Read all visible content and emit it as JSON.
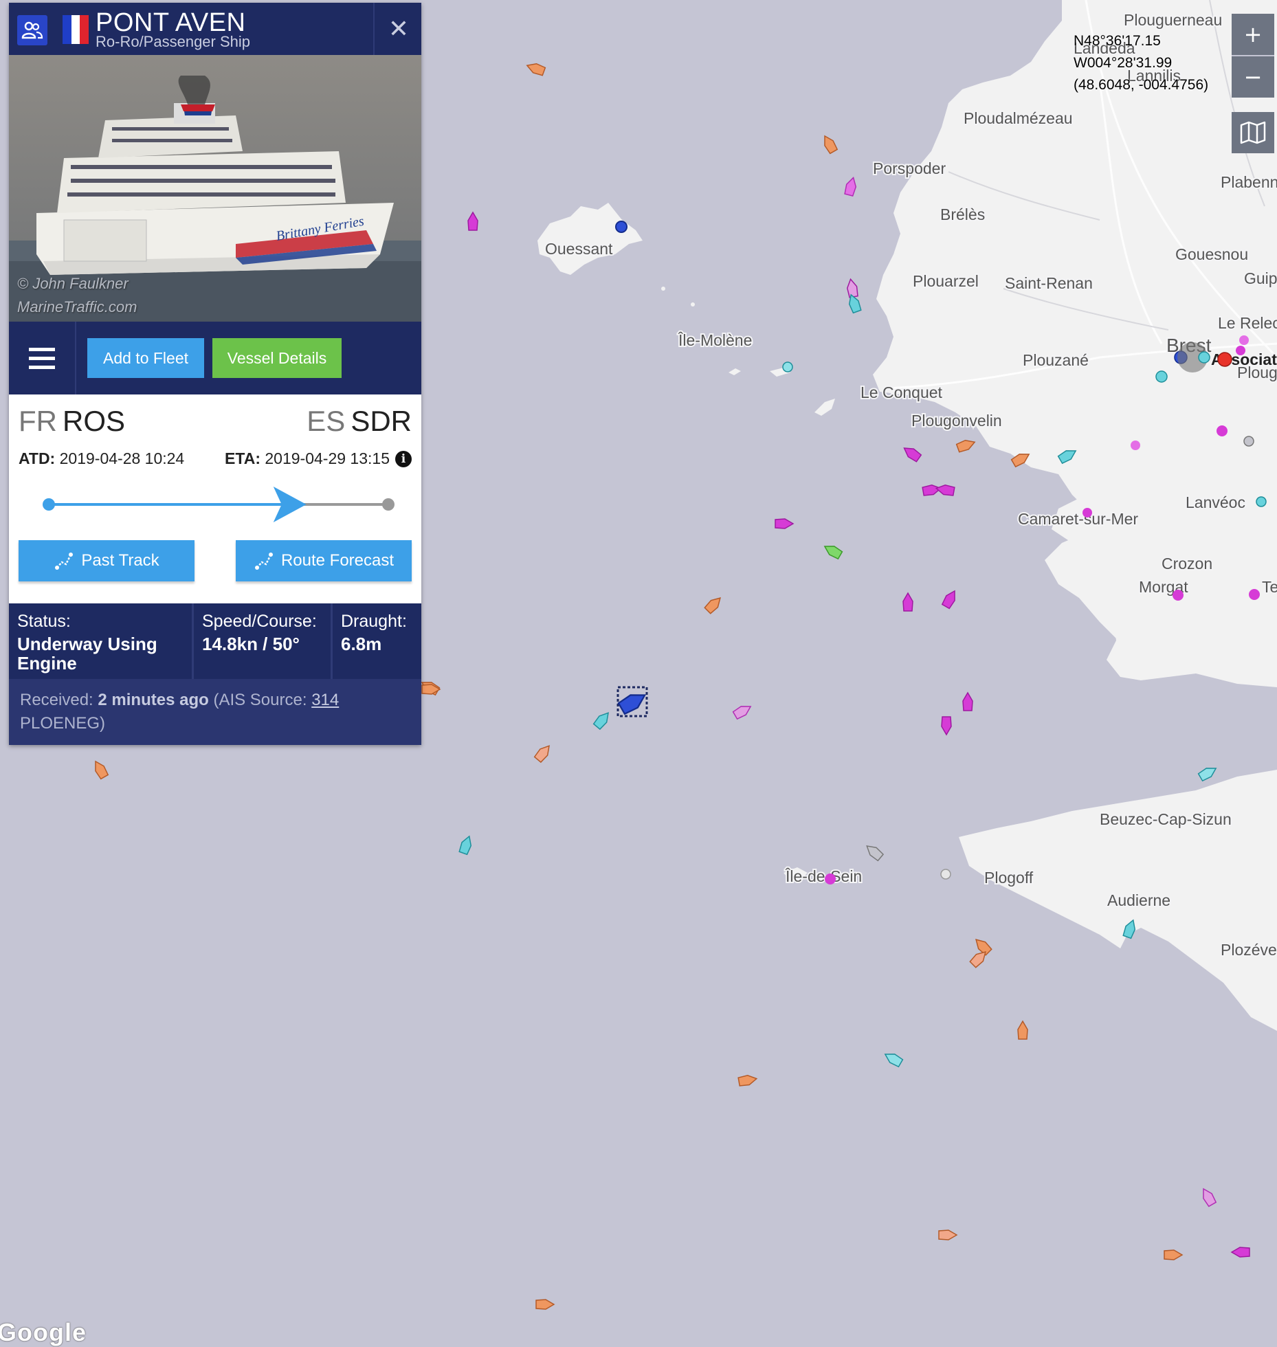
{
  "vessel": {
    "name": "PONT AVEN",
    "type": "Ro-Ro/Passenger Ship",
    "flag_colors": [
      "#1f3ec7",
      "#ffffff",
      "#e0242e"
    ],
    "photo_credit_line1": "© John Faulkner",
    "photo_credit_line2": "MarineTraffic.com",
    "ship_livery": "Brittany Ferries"
  },
  "actions": {
    "add_fleet": "Add to Fleet",
    "vessel_details": "Vessel Details",
    "past_track": "Past Track",
    "route_forecast": "Route Forecast"
  },
  "voyage": {
    "from_country": "FR",
    "from_port": "ROS",
    "to_country": "ES",
    "to_port": "SDR",
    "atd_label": "ATD:",
    "atd_value": "2019-04-28 10:24",
    "eta_label": "ETA:",
    "eta_value": "2019-04-29 13:15",
    "progress_fraction": 0.71
  },
  "status": {
    "status_label": "Status:",
    "status_value": "Underway Using Engine",
    "speed_label": "Speed/Course:",
    "speed_value": "14.8kn / 50°",
    "draught_label": "Draught:",
    "draught_value": "6.8m",
    "received_label": "Received:",
    "received_value": "2 minutes ago",
    "ais_source_label": "(AIS Source:",
    "ais_source_id": "314",
    "ais_source_station": "PLOENEG)"
  },
  "map": {
    "coord_lat": "N48°36'17.15",
    "coord_lon": "W004°28'31.99",
    "coord_decimal": "(48.6048, -004.4756)",
    "zoom_in": "+",
    "zoom_out": "−",
    "layers_icon": "map-icon",
    "google_logo": "Google",
    "places": [
      "Plouguerneau",
      "Landeda",
      "Lannilis",
      "Ploudalmézeau",
      "Porspoder",
      "Plabennec",
      "Brélès",
      "Gouesnou",
      "Ouessant",
      "Guip",
      "Plouarzel",
      "Saint-Renan",
      "Le Relec",
      "Île-Molène",
      "Brest",
      "Association",
      "Ploug",
      "Plouzané",
      "Le Conquet",
      "Plougonvelin",
      "Lanvéoc",
      "Camaret-sur-Mer",
      "Crozon",
      "Morgat",
      "Te",
      "Beuzec-Cap-Sizun",
      "Île-de-Sein",
      "Plogoff",
      "Audierne",
      "Plozéve"
    ]
  },
  "colors": {
    "panel_navy": "#1e2a61",
    "accent_blue": "#3da0e8",
    "accent_green": "#6cc24a",
    "sea": "#c5c5d4",
    "land": "#f2f2f2"
  }
}
